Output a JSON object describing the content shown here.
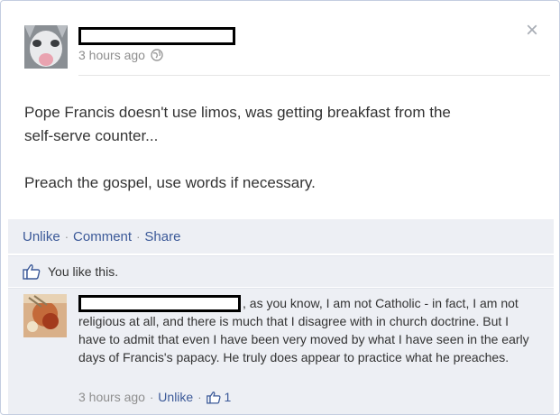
{
  "post": {
    "timestamp": "3 hours ago",
    "privacy_icon": "globe-icon",
    "text_line1": "Pope Francis doesn't use limos, was getting breakfast from the",
    "text_line2": "self-serve counter...",
    "text_line3": "Preach the gospel, use words if necessary."
  },
  "actions": {
    "unlike": "Unlike",
    "comment": "Comment",
    "share": "Share",
    "separator": "·"
  },
  "likes": {
    "text": "You like this."
  },
  "comment": {
    "text_first": ", as you know, I am not Catholic - in fact, I",
    "text_rest": "am not religious at all, and there is much that I disagree with in church doctrine. But I have to admit that even I have been very moved by what I have seen in the early days of Francis's papacy. He truly does appear to practice what he preaches.",
    "timestamp": "3 hours ago",
    "unlike": "Unlike",
    "like_count": "1"
  },
  "colors": {
    "link": "#3b5998",
    "bar_bg": "#edeff4",
    "muted": "#8e8e8e"
  }
}
